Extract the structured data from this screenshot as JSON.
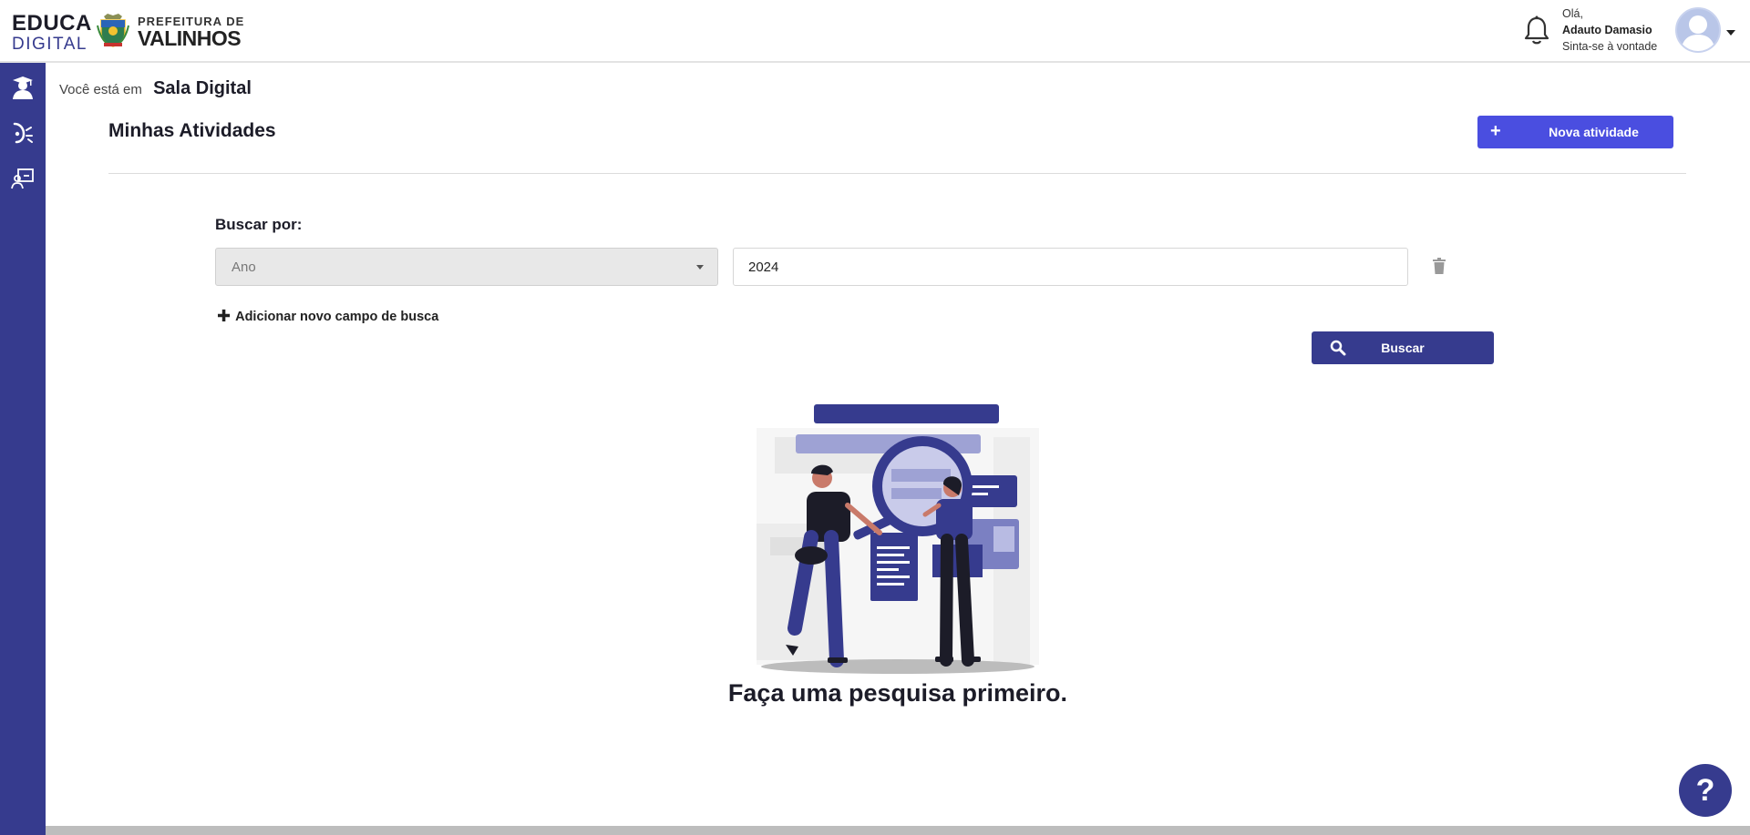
{
  "header": {
    "logo_educa_line1": "EDUCA",
    "logo_educa_line2": "DIGITAL",
    "logo_pref_line1": "PREFEITURA DE",
    "logo_pref_line2": "VALINHOS",
    "greeting": "Olá,",
    "user_name": "Adauto Damasio",
    "user_subtitle": "Sinta-se à vontade"
  },
  "sidebar": {
    "items": [
      {
        "icon": "student-icon"
      },
      {
        "icon": "activity-icon"
      },
      {
        "icon": "classroom-icon"
      }
    ]
  },
  "breadcrumb": {
    "prefix": "Você está em",
    "current": "Sala Digital"
  },
  "page": {
    "title": "Minhas Atividades",
    "new_button_label": "Nova atividade"
  },
  "search": {
    "label": "Buscar por:",
    "field_select_value": "Ano",
    "field_input_value": "2024",
    "add_field_label": "Adicionar novo campo de busca",
    "search_button_label": "Buscar"
  },
  "empty_state": {
    "message": "Faça uma pesquisa primeiro."
  },
  "help": {
    "label": "?"
  },
  "colors": {
    "sidebar": "#363b8e",
    "primary_button": "#4a4ee0",
    "search_button": "#363b8e"
  }
}
